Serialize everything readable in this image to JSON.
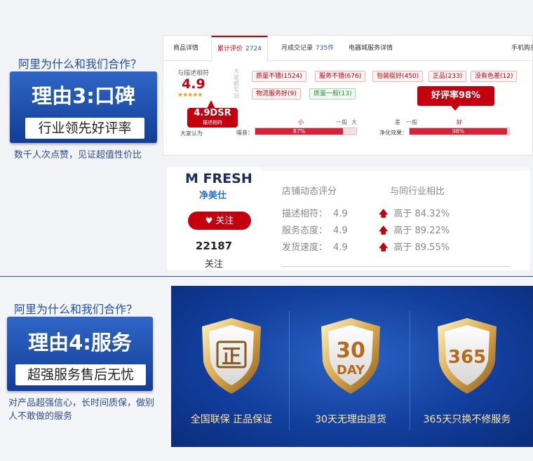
{
  "reason3": {
    "question": "阿里为什么和我们合作？",
    "title": "理由3:口碑",
    "subtitle": "行业领先好评率",
    "note": "数千人次点赞，见证超值性价比"
  },
  "review_panel": {
    "tabs": [
      {
        "label": "商品详情",
        "count": ""
      },
      {
        "label": "累计评价",
        "count": "2724"
      },
      {
        "label": "月成交记录",
        "count": "735件"
      },
      {
        "label": "电器城服务详情",
        "count": ""
      },
      {
        "label": "手机购买",
        "count": ""
      }
    ],
    "score_label": "与描述相符",
    "score_value": "4.9",
    "stars": "★★★★★",
    "vertical_label": "大家都写到",
    "tags": [
      {
        "text": "质量不错(1524)",
        "tone": "red"
      },
      {
        "text": "服务不错(676)",
        "tone": "red"
      },
      {
        "text": "包装挺好(450)",
        "tone": "red"
      },
      {
        "text": "正品(233)",
        "tone": "red"
      },
      {
        "text": "没有色差(12)",
        "tone": "red"
      },
      {
        "text": "物流服务好(9)",
        "tone": "red"
      },
      {
        "text": "质量一般(13)",
        "tone": "green"
      }
    ],
    "dsr_badge_big": "4.9DSR",
    "dsr_badge_small": "描述相符",
    "consensus_label": "大家认为",
    "rate_bubble": "好评率98%",
    "noise": {
      "name": "噪音：",
      "scale_left": "小",
      "scale_mid": "一般",
      "scale_right": "大",
      "percent_label": "87%",
      "percent": 87
    },
    "purify": {
      "name": "净化效果：",
      "scale_left": "差",
      "scale_mid": "一般",
      "scale_right": "好",
      "percent_label": "98%",
      "percent": 98
    }
  },
  "shop": {
    "logo_m": "M",
    "logo_en": "FRESH",
    "logo_cn": "净美仕",
    "follow_label": "关注",
    "follower_count": "22187",
    "follower_label": "关注",
    "dynamic_header": "店铺动态评分",
    "compare_header": "与同行业相比",
    "rows": [
      {
        "label": "描述相符：",
        "value": "4.9",
        "compare": "高于 84.32%"
      },
      {
        "label": "服务态度：",
        "value": "4.9",
        "compare": "高于 89.22%"
      },
      {
        "label": "发货速度：",
        "value": "4.9",
        "compare": "高于 89.55%"
      }
    ]
  },
  "reason4": {
    "question": "阿里为什么和我们合作？",
    "title": "理由4:服务",
    "subtitle": "超强服务售后无忧",
    "note": "对产品超强信心，长时间质保，做别人不敢做的服务"
  },
  "service": {
    "shields": [
      {
        "emblem": "正",
        "emblem2": "",
        "caption": "全国联保 正品保证"
      },
      {
        "emblem": "30",
        "emblem2": "DAY",
        "caption": "30天无理由退货"
      },
      {
        "emblem": "365",
        "emblem2": "",
        "caption": "365天只换不修服务"
      }
    ]
  },
  "colors": {
    "brand_red": "#c4000f",
    "brand_blue": "#1c4fae",
    "gold": "#d8a64a"
  }
}
